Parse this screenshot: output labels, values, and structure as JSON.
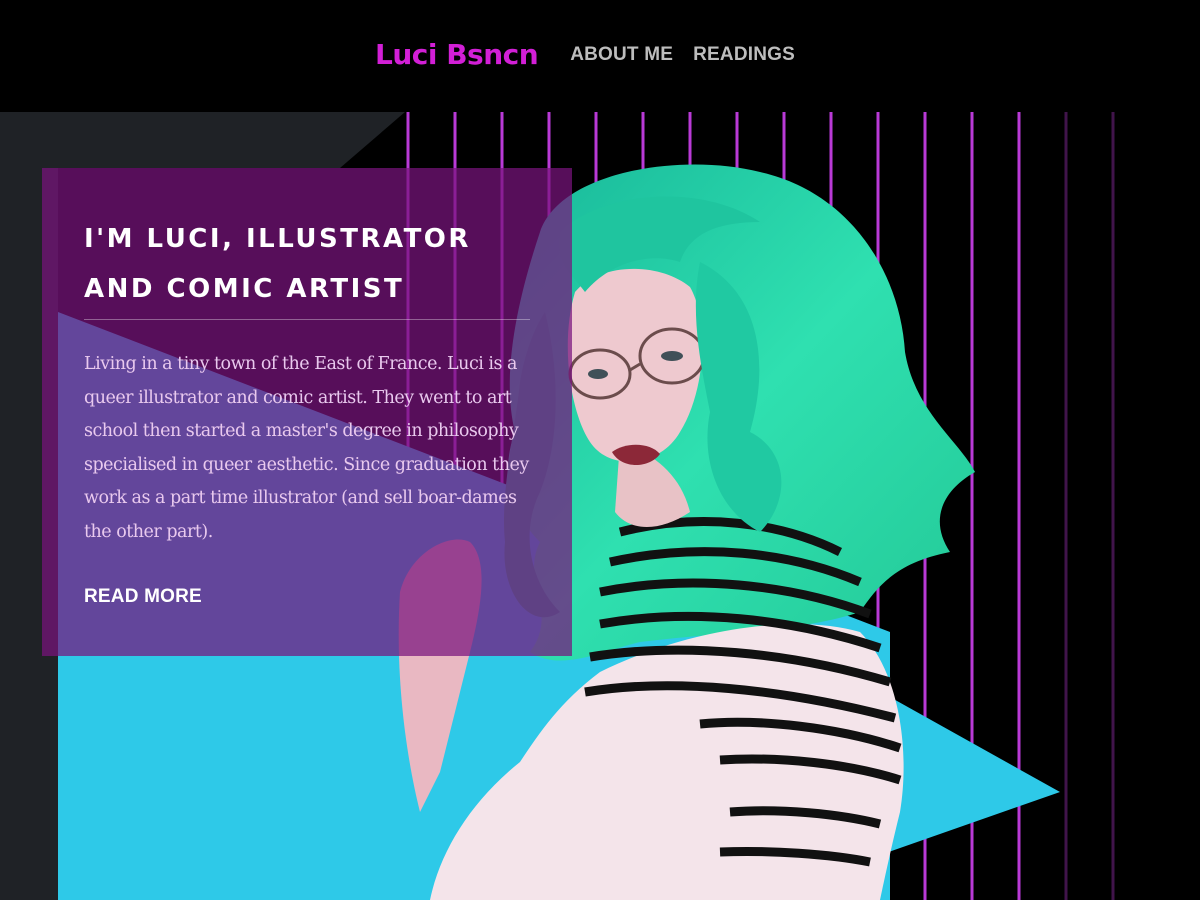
{
  "header": {
    "brand": "Luci Bsncn",
    "nav": [
      {
        "label": "ABOUT ME"
      },
      {
        "label": "READINGS"
      }
    ]
  },
  "hero": {
    "title": "I'M LUCI, ILLUSTRATOR AND COMIC ARTIST",
    "description": "Living in a tiny town of the East of France. Luci is a queer illustrator and comic artist. They went to art school then started a master's degree in philosophy specialised in queer aesthetic. Since graduation they work as a part time illustrator (and sell boar-dames the other part).",
    "cta": "READ MORE",
    "image_icon": "portrait-photo"
  },
  "colors": {
    "brand": "#d21fd6",
    "panel": "#7a147d",
    "grid": "#b93ad6",
    "cyan": "#2ec9e8",
    "slate": "#1f2226",
    "hair": "#27d9a8"
  }
}
